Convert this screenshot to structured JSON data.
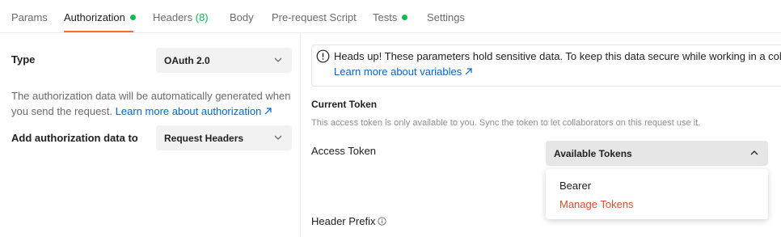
{
  "tabs": [
    {
      "label": "Params"
    },
    {
      "label": "Authorization",
      "status_dot": true
    },
    {
      "label": "Headers ",
      "count": "(8)"
    },
    {
      "label": "Body"
    },
    {
      "label": "Pre-request Script"
    },
    {
      "label": "Tests",
      "status_dot": true
    },
    {
      "label": "Settings"
    }
  ],
  "active_tab": "Authorization",
  "left": {
    "type_label": "Type",
    "type_value": "OAuth 2.0",
    "description": "The authorization data will be automatically generated when you send the request.",
    "description_link": "Learn more about authorization",
    "add_to_label": "Add authorization data to",
    "add_to_value": "Request Headers"
  },
  "warning": {
    "message": "Heads up! These parameters hold sensitive data. To keep this data secure while working in a collab",
    "link": "Learn more about variables"
  },
  "current_token": {
    "title": "Current Token",
    "subtitle": "This access token is only available to you. Sync the token to let collaborators on this request use it.",
    "access_token_label": "Access Token",
    "available_tokens_label": "Available Tokens",
    "dropdown_items": [
      {
        "label": "Bearer"
      },
      {
        "label": "Manage Tokens"
      }
    ],
    "header_prefix_label": "Header Prefix"
  },
  "colors": {
    "accent": "#ff6c37",
    "status_green": "#0cbb52",
    "link": "#0265d2",
    "manage_link": "#d1522a"
  }
}
